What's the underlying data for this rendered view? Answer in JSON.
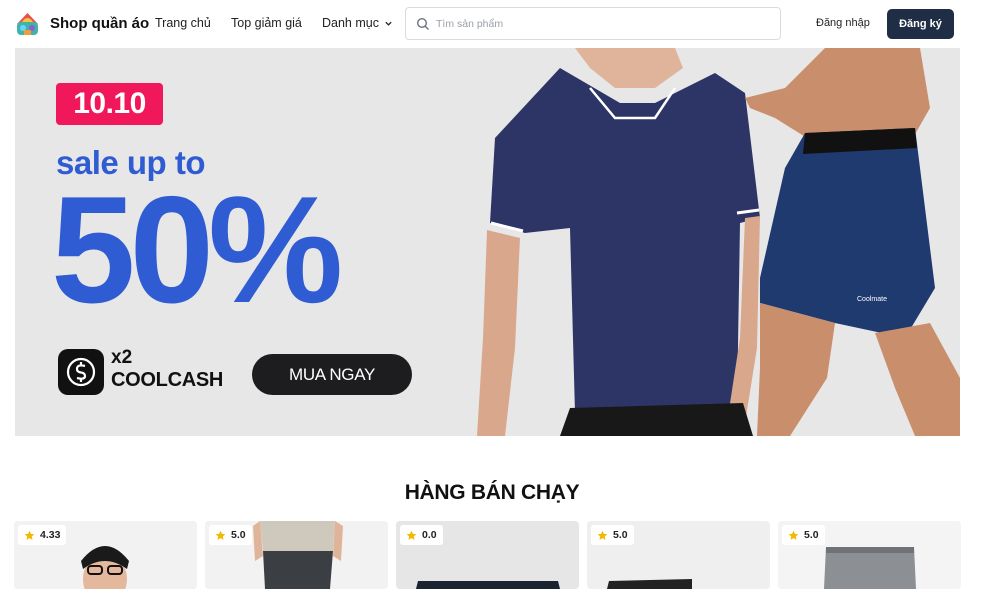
{
  "header": {
    "brand": "Shop quần áo",
    "nav": {
      "home": "Trang chủ",
      "top_deals": "Top giảm giá",
      "categories": "Danh mục"
    },
    "search": {
      "placeholder": "Tìm sản phẩm",
      "value": ""
    },
    "login": "Đăng nhập",
    "register": "Đăng ký"
  },
  "banner": {
    "badge": "10.10",
    "headline": "sale up to",
    "percent": "50%",
    "coolcash_multiplier": "x2",
    "coolcash_label": "COOLCASH",
    "cta": "MUA NGAY",
    "colors": {
      "accent_blue": "#2f5bd3",
      "badge_pink": "#f0185a"
    }
  },
  "best_sellers": {
    "title": "HÀNG BÁN CHẠY",
    "products": [
      {
        "rating": "4.33"
      },
      {
        "rating": "5.0"
      },
      {
        "rating": "0.0"
      },
      {
        "rating": "5.0"
      },
      {
        "rating": "5.0"
      }
    ]
  },
  "icons": [
    "logo-icon",
    "chevron-down-icon",
    "search-icon",
    "coolcash-icon",
    "star-icon"
  ]
}
